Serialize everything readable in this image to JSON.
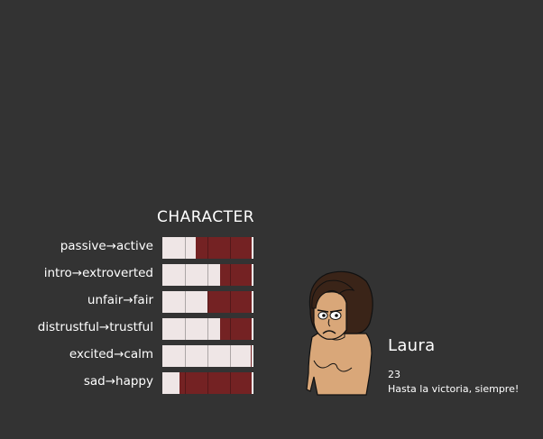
{
  "panel_title": "CHARACTER",
  "traits": [
    {
      "label": "passive→active",
      "value": 0.37
    },
    {
      "label": "intro→extroverted",
      "value": 0.64
    },
    {
      "label": "unfair→fair",
      "value": 0.5
    },
    {
      "label": "distrustful→trustful",
      "value": 0.64
    },
    {
      "label": "excited→calm",
      "value": 0.98
    },
    {
      "label": "sad→happy",
      "value": 0.19
    }
  ],
  "colors": {
    "background": "#333333",
    "bar_fill": "#efe6e6",
    "bar_remainder": "#742223",
    "text": "#ffffff"
  },
  "profile": {
    "name": "Laura",
    "age": "23",
    "motto": "Hasta la victoria, siempre!",
    "avatar_icon": "sad-woman-portrait"
  }
}
